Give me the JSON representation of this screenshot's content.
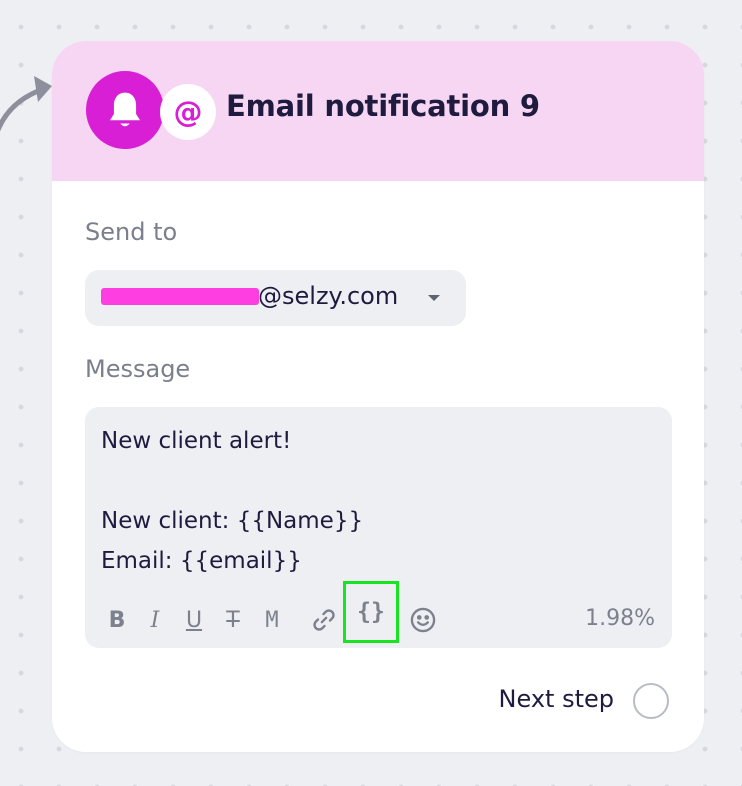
{
  "node": {
    "title": "Email notification 9",
    "at_symbol": "@"
  },
  "send_to": {
    "label": "Send to",
    "recipient_visible": "@selzy.com"
  },
  "message": {
    "label": "Message",
    "text": "New client alert!\n\nNew client: {{Name}}\nEmail: {{email}}"
  },
  "toolbar": {
    "bold": "B",
    "italic": "I",
    "underline": "U",
    "strikethrough": "T",
    "monospace": "M",
    "variables": "{}",
    "char_usage": "1.98%"
  },
  "footer": {
    "next_step": "Next step"
  },
  "colors": {
    "brand": "#d91fd5",
    "header_bg": "#f6d6f2",
    "highlight": "#17e51f"
  }
}
